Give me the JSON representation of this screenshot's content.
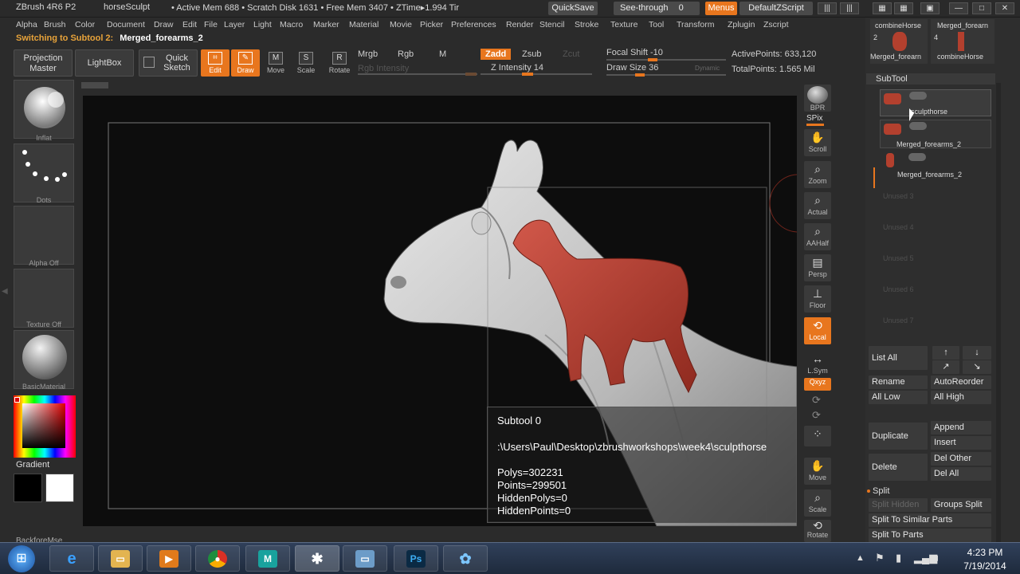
{
  "titlebar": {
    "app": "ZBrush 4R6 P2",
    "document": "horseSculpt",
    "stats": "• Active Mem 688 • Scratch Disk 1631 • Free Mem 3407 • ZTime▸1.994 Tir",
    "quicksave": "QuickSave",
    "seethrough_label": "See-through",
    "seethrough_value": "0",
    "menus": "Menus",
    "zscript": "DefaultZScript"
  },
  "menus": [
    "Alpha",
    "Brush",
    "Color",
    "Document",
    "Draw",
    "Edit",
    "File",
    "Layer",
    "Light",
    "Macro",
    "Marker",
    "Material",
    "Movie",
    "Picker",
    "Preferences",
    "Render",
    "Stencil",
    "Stroke",
    "Texture",
    "Tool",
    "Transform",
    "Zplugin",
    "Zscript"
  ],
  "status": {
    "message": "Switching to Subtool 2:",
    "name": "Merged_forearms_2"
  },
  "toolbar": {
    "projection_master": "Projection Master",
    "lightbox": "LightBox",
    "quick_sketch": "Quick Sketch",
    "edit": "Edit",
    "draw": "Draw",
    "move": "Move",
    "scale": "Scale",
    "rotate": "Rotate",
    "mrgb": "Mrgb",
    "rgb": "Rgb",
    "m": "M",
    "rgb_intensity": "Rgb Intensity",
    "zadd": "Zadd",
    "zsub": "Zsub",
    "zcut": "Zcut",
    "z_intensity": "Z Intensity 14",
    "focal_shift": "Focal Shift -10",
    "draw_size": "Draw Size 36",
    "dynamic": "Dynamic",
    "active_points": "ActivePoints: 633,120",
    "total_points": "TotalPoints: 1.565 Mil"
  },
  "left_shelf": {
    "brush": "Inflat",
    "stroke": "Dots",
    "alpha": "Alpha Off",
    "texture": "Texture Off",
    "material": "BasicMaterial",
    "gradient": "Gradient",
    "bottom": "BackforeMse"
  },
  "right_strip": [
    "BPR",
    "SPix",
    "Scroll",
    "Zoom",
    "Actual",
    "AAHalf",
    "Persp",
    "Floor",
    "Local",
    "L.Sym",
    "Qxyz",
    "",
    "",
    "",
    "Move",
    "Scale",
    "Rotate"
  ],
  "tool_thumbs": {
    "top_left": "combineHorse",
    "top_right": "Merged_forearn",
    "count_left": "2",
    "count_right": "4",
    "bottom_left": "Merged_forearn",
    "bottom_right": "combineHorse"
  },
  "subtool": {
    "title": "SubTool",
    "items": [
      "sculpthorse",
      "Merged_forearms_2",
      "Merged_forearms_2"
    ],
    "unused": [
      "Unused 3",
      "Unused 4",
      "Unused 5",
      "Unused 6",
      "Unused 7"
    ],
    "list_all": "List All",
    "rename": "Rename",
    "autoreorder": "AutoReorder",
    "all_low": "All Low",
    "all_high": "All High",
    "duplicate": "Duplicate",
    "append": "Append",
    "insert": "Insert",
    "delete": "Delete",
    "del_other": "Del Other",
    "del_all": "Del All",
    "split": "Split",
    "split_hidden": "Split Hidden",
    "groups_split": "Groups Split",
    "split_similar": "Split To Similar Parts",
    "split_parts": "Split To Parts"
  },
  "info_popup": {
    "subtool": "Subtool 0",
    "path": ":\\Users\\Paul\\Desktop\\zbrushworkshops\\week4\\sculpthorse",
    "polys": "Polys=302231",
    "points": "Points=299501",
    "hidden_polys": "HiddenPolys=0",
    "hidden_points": "HiddenPoints=0"
  },
  "taskbar": {
    "time": "4:23 PM",
    "date": "7/19/2014",
    "apps": [
      "ie-icon",
      "explorer-icon",
      "media-player-icon",
      "chrome-icon",
      "maya-icon",
      "zbrush-icon",
      "preview-icon",
      "photoshop-icon",
      "flower-app-icon"
    ]
  },
  "colors": {
    "accent": "#e8761e",
    "muscle": "#b3402e",
    "canvas": "#0d0d0d"
  }
}
